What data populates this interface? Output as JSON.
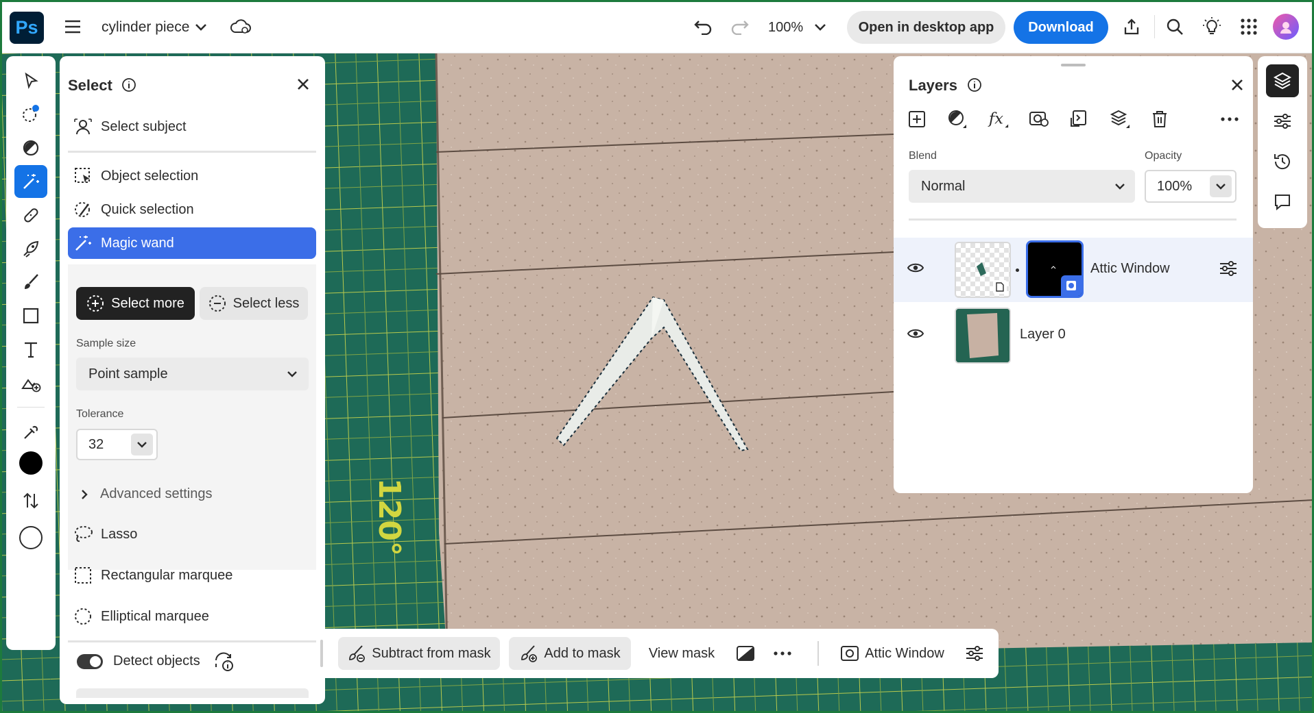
{
  "app": {
    "logo_text": "Ps",
    "document_title": "cylinder piece",
    "zoom": "100%",
    "open_desktop_label": "Open in desktop app",
    "download_label": "Download",
    "accent_color": "#1473e6",
    "brand_color": "#001e36"
  },
  "canvas": {
    "ruler_label": "120°"
  },
  "toolbar": {
    "tools": [
      {
        "name": "move-tool",
        "icon": "arrow-icon"
      },
      {
        "name": "quick-action-tool",
        "icon": "sparkle-select-icon"
      },
      {
        "name": "adjust-tool",
        "icon": "contrast-icon"
      },
      {
        "name": "magic-wand-tool",
        "icon": "magic-wand-icon",
        "active": true
      },
      {
        "name": "heal-tool",
        "icon": "bandage-icon"
      },
      {
        "name": "clone-tool",
        "icon": "rocket-icon"
      },
      {
        "name": "brush-tool",
        "icon": "brush-icon"
      },
      {
        "name": "shape-tool",
        "icon": "rectangle-icon"
      },
      {
        "name": "type-tool",
        "icon": "text-icon"
      },
      {
        "name": "add-image-tool",
        "icon": "image-add-icon"
      },
      {
        "name": "eyedropper-tool",
        "icon": "eyedropper-icon"
      }
    ],
    "foreground_color": "#000000",
    "background_color": "#ffffff"
  },
  "select_panel": {
    "title": "Select",
    "select_subject": "Select subject",
    "object_selection": "Object selection",
    "quick_selection": "Quick selection",
    "magic_wand": "Magic wand",
    "select_more": "Select more",
    "select_less": "Select less",
    "sample_size_label": "Sample size",
    "sample_size_value": "Point sample",
    "tolerance_label": "Tolerance",
    "tolerance_value": "32",
    "advanced_settings": "Advanced settings",
    "lasso": "Lasso",
    "rectangular_marquee": "Rectangular marquee",
    "elliptical_marquee": "Elliptical marquee",
    "detect_objects": "Detect objects"
  },
  "layers_panel": {
    "title": "Layers",
    "blend_label": "Blend",
    "blend_value": "Normal",
    "opacity_label": "Opacity",
    "opacity_value": "100%",
    "layers": [
      {
        "name": "Attic Window",
        "selected": true,
        "has_mask": true
      },
      {
        "name": "Layer 0",
        "selected": false,
        "has_mask": false
      }
    ]
  },
  "context_bar": {
    "subtract_from_mask": "Subtract from mask",
    "add_to_mask": "Add to mask",
    "view_mask": "View mask",
    "layer_name": "Attic Window"
  }
}
